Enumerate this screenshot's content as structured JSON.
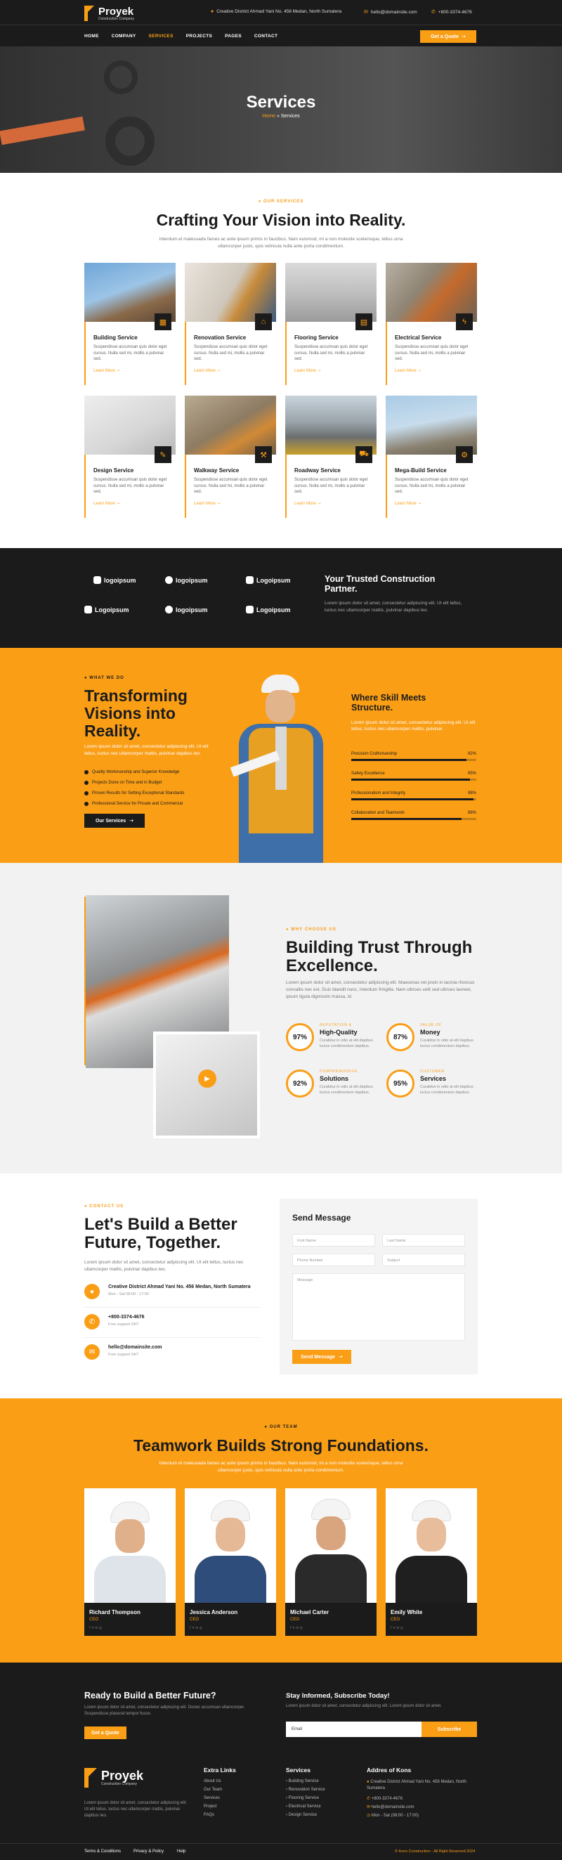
{
  "header": {
    "brand": "Proyek",
    "brand_sub": "Construction Company",
    "address": "Creative District Ahmad Yani No. 456 Medan, North Sumatera",
    "email": "hello@domainsite.com",
    "phone": "+800-3374-4676",
    "nav": [
      "HOME",
      "COMPANY",
      "SERVICES",
      "PROJECTS",
      "PAGES",
      "CONTACT"
    ],
    "active_nav": "SERVICES",
    "quote_button": "Get a Quote"
  },
  "hero": {
    "title": "Services",
    "crumb_home": "Home",
    "crumb_current": "Services"
  },
  "services": {
    "tag": "OUR SERVICES",
    "title": "Crafting Your Vision into Reality.",
    "desc": "Interdum et malesuada fames ac ante ipsum primis in faucibus. Nam euismod, mi a non molestie scelerisque, tellus urna ullamcorper justo, quis vehicula nulla ante porta condimentum.",
    "items": [
      {
        "name": "Building Service",
        "desc": "Suspendisse accumsan quis dolor eget cursus. Nulla sed mi, mollis a pulvinar sed.",
        "more": "Learn More"
      },
      {
        "name": "Renovation Service",
        "desc": "Suspendisse accumsan quis dolor eget cursus. Nulla sed mi, mollis a pulvinar sed.",
        "more": "Learn More"
      },
      {
        "name": "Flooring Service",
        "desc": "Suspendisse accumsan quis dolor eget cursus. Nulla sed mi, mollis a pulvinar sed.",
        "more": "Learn More"
      },
      {
        "name": "Electrical Service",
        "desc": "Suspendisse accumsan quis dolor eget cursus. Nulla sed mi, mollis a pulvinar sed.",
        "more": "Learn More"
      },
      {
        "name": "Design Service",
        "desc": "Suspendisse accumsan quis dolor eget cursus. Nulla sed mi, mollis a pulvinar sed.",
        "more": "Learn More"
      },
      {
        "name": "Walkway Service",
        "desc": "Suspendisse accumsan quis dolor eget cursus. Nulla sed mi, mollis a pulvinar sed.",
        "more": "Learn More"
      },
      {
        "name": "Roadway Service",
        "desc": "Suspendisse accumsan quis dolor eget cursus. Nulla sed mi, mollis a pulvinar sed.",
        "more": "Learn More"
      },
      {
        "name": "Mega-Build Service",
        "desc": "Suspendisse accumsan quis dolor eget cursus. Nulla sed mi, mollis a pulvinar sed.",
        "more": "Learn More"
      }
    ]
  },
  "partners": {
    "logos": [
      "logoipsum",
      "logoipsum",
      "Logoipsum",
      "Logoipsum",
      "logoipsum",
      "Logoipsum"
    ],
    "title": "Your Trusted Construction Partner.",
    "desc": "Lorem ipsum dolor sit amet, consectetur adipiscing elit. Ut elit tellus, luctus nec ullamcorper mattis, pulvinar dapibus leo."
  },
  "what": {
    "tag": "WHAT WE DO",
    "title": "Transforming Visions into Reality.",
    "desc": "Lorem ipsum dolor sit amet, consectetur adipiscing elit. Ut elit tellus, luctus nec ullamcorper mattis, pulvinar dapibus leo.",
    "bullets": [
      "Quality Workmanship and Superior Knowledge",
      "Projects Done on Time and in Budget",
      "Proven Results for Setting Exceptional Standards",
      "Professional Service for Private and Commercial"
    ],
    "button": "Our Services",
    "skill_title": "Where Skill Meets Structure.",
    "skill_desc": "Lorem ipsum dolor sit amet, consectetur adipiscing elit. Ut elit tellus, luctus nec ullamcorper mattis, pulvinar.",
    "skills": [
      {
        "label": "Precision Craftsmanship",
        "value": "92%",
        "pct": 0.92
      },
      {
        "label": "Safety Excellence",
        "value": "95%",
        "pct": 0.95
      },
      {
        "label": "Professionalism and Integrity",
        "value": "98%",
        "pct": 0.98
      },
      {
        "label": "Collaboration and Teamwork",
        "value": "88%",
        "pct": 0.88
      }
    ]
  },
  "why": {
    "tag": "WHY CHOOSE US",
    "title": "Building Trust Through Excellence.",
    "desc": "Lorem ipsum dolor sit amet, consectetur adipiscing elit. Maecenas vel proin in lacinia rhoncus convallis nec est. Duis blandit nunc, Interdum fringilla. Nam ultrices velit sed ultrices laoreet, ipsum ligula dignissim massa, id.",
    "stats": [
      {
        "value": "97%",
        "caption": "REPUTATION &",
        "title": "High-Quality",
        "desc": "Curabitur in odio at elit dapibus luctus condimentum dapibus."
      },
      {
        "value": "87%",
        "caption": "VALUE OF",
        "title": "Money",
        "desc": "Curabitur in odio at elit dapibus luctus condimentum dapibus."
      },
      {
        "value": "92%",
        "caption": "COMPREHENSIVE",
        "title": "Solutions",
        "desc": "Curabitur in odio at elit dapibus luctus condimentum dapibus."
      },
      {
        "value": "95%",
        "caption": "CUSTOMER",
        "title": "Services",
        "desc": "Curabitur in odio at elit dapibus luctus condimentum dapibus."
      }
    ]
  },
  "contact": {
    "tag": "CONTACT US",
    "title": "Let's Build a Better Future, Together.",
    "desc": "Lorem ipsum dolor sit amet, consectetur adipiscing elit. Ut elit tellus, luctus nec ullamcorper mattis, pulvinar dapibus leo.",
    "items": [
      {
        "title": "Creative District Ahmad Yani No. 456 Medan, North Sumatera",
        "sub": "Mon - Sat 08:00 - 17:00"
      },
      {
        "title": "+800-3374-4676",
        "sub": "Free support 24/7"
      },
      {
        "title": "hello@domainsite.com",
        "sub": "Free support 24/7"
      }
    ],
    "form_title": "Send Message",
    "placeholders": {
      "first": "First Name",
      "last": "Last Name",
      "phone": "Phone Number",
      "subject": "Subject",
      "message": "Message"
    },
    "send": "Send Message"
  },
  "team": {
    "tag": "OUR TEAM",
    "title": "Teamwork Builds Strong Foundations.",
    "desc": "Interdum et malesuada fames ac ante ipsum primis in faucibus. Nam euismod, mi a non molestie scelerisque, tellus urna ullamcorper justo, quis vehicula nulla ante porta condimentum.",
    "members": [
      {
        "name": "Richard Thompson",
        "role": "CEO"
      },
      {
        "name": "Jessica Anderson",
        "role": "CEO"
      },
      {
        "name": "Michael Carter",
        "role": "CEO"
      },
      {
        "name": "Emily White",
        "role": "CEO"
      }
    ]
  },
  "footer": {
    "cta_title": "Ready to Build a Better Future?",
    "cta_desc": "Lorem ipsum dolor sit amet, consectetur adipiscing elit. Donec accumsan ullamcorper. Suspendisse placerat tempor fusce.",
    "cta_button": "Get a Quote",
    "sub_title": "Stay Informed, Subscribe Today!",
    "sub_desc": "Lorem ipsum dolor sit amet, consectetur adipiscing elit. Lorem ipsum dolor sit amet.",
    "sub_placeholder": "Email",
    "sub_button": "Subscribe",
    "about": "Lorem ipsum dolor sit amet, consectetur adipiscing elit. Ut elit tellus, luctus nec ullamcorper mattis, pulvinar dapibus leo.",
    "links_title": "Extra Links",
    "links": [
      "About Us",
      "Our Team",
      "Services",
      "Project",
      "FAQs"
    ],
    "services_title": "Services",
    "services": [
      "Building Service",
      "Renovation Service",
      "Flooring Service",
      "Electrical Service",
      "Design Service"
    ],
    "address_title": "Addres of Kons",
    "address": "Creative District Ahmad Yani No. 456 Medan, North Sumatera",
    "phone": "+800-3374-4676",
    "email": "hello@domainsite.com",
    "hours": "Mon - Sat (08:00 - 17:00)",
    "legal": [
      "Terms & Conditions",
      "Privacy & Policy",
      "Help"
    ],
    "copyright": "© Kons Construction - All Right Reserved 2024"
  }
}
